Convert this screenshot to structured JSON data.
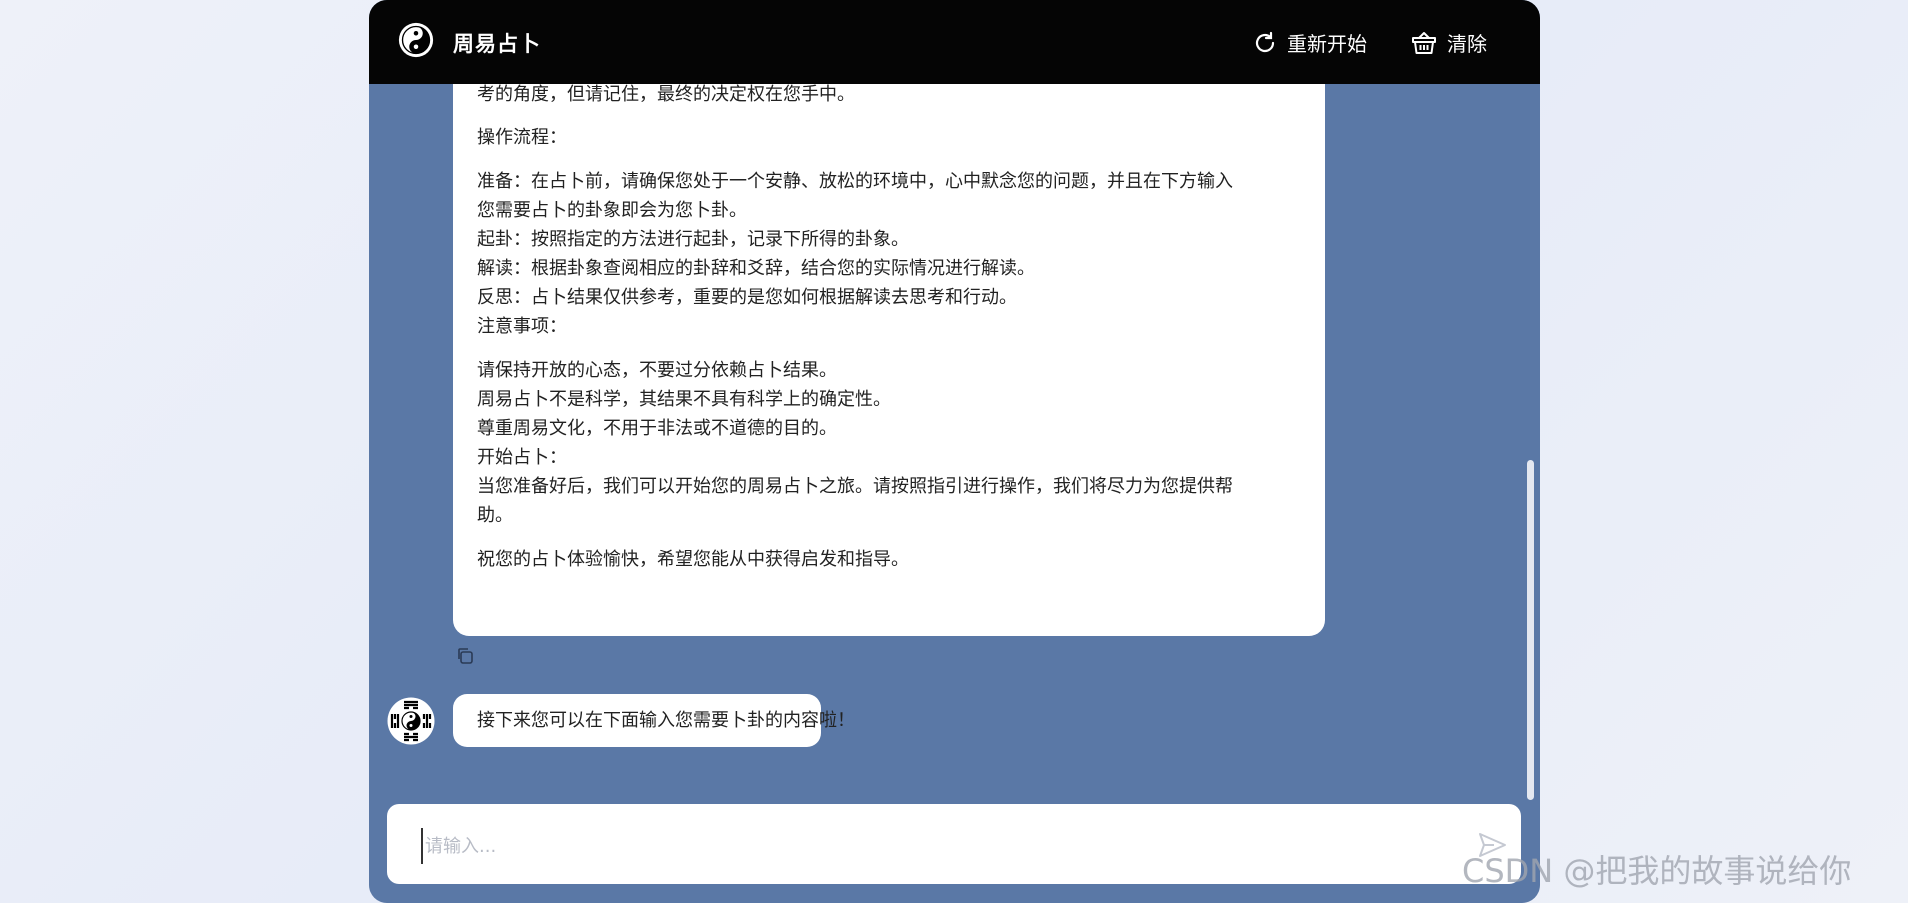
{
  "header": {
    "title": "周易占卜",
    "restart_label": "重新开始",
    "clear_label": "清除"
  },
  "messages": {
    "long_lines": [
      "考的角度，但请记住，最终的决定权在您手中。",
      "操作流程：",
      "准备：在占卜前，请确保您处于一个安静、放松的环境中，心中默念您的问题，并且在下方输入",
      "您需要占卜的卦象即会为您卜卦。",
      "起卦：按照指定的方法进行起卦，记录下所得的卦象。",
      "解读：根据卦象查阅相应的卦辞和爻辞，结合您的实际情况进行解读。",
      "反思：占卜结果仅供参考，重要的是您如何根据解读去思考和行动。",
      "注意事项：",
      "请保持开放的心态，不要过分依赖占卜结果。",
      "周易占卜不是科学，其结果不具有科学上的确定性。",
      "尊重周易文化，不用于非法或不道德的目的。",
      "开始占卜：",
      "当您准备好后，我们可以开始您的周易占卜之旅。请按照指引进行操作，我们将尽力为您提供帮",
      "助。",
      "祝您的占卜体验愉快，希望您能从中获得启发和指导。"
    ],
    "short": "接下来您可以在下面输入您需要卜卦的内容啦！"
  },
  "composer": {
    "placeholder": "请输入...",
    "value": ""
  },
  "watermark": "CSDN @把我的故事说给你",
  "icons": {
    "logo": "yin-yang-icon",
    "restart": "refresh-icon",
    "clear": "basket-icon",
    "copy": "copy-icon",
    "send": "send-icon"
  }
}
